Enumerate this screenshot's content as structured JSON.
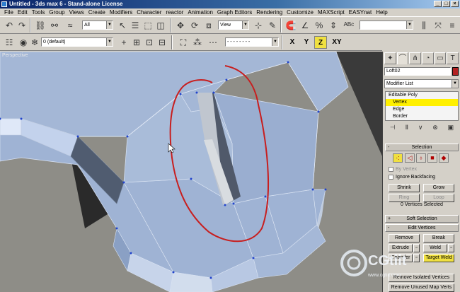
{
  "window": {
    "title": "Untitled - 3ds max 6 - Stand-alone License"
  },
  "menu": [
    "File",
    "Edit",
    "Tools",
    "Group",
    "Views",
    "Create",
    "Modifiers",
    "Character",
    "reactor",
    "Animation",
    "Graph Editors",
    "Rendering",
    "Customize",
    "MAXScript",
    "EASYnat",
    "Help"
  ],
  "toolbar": {
    "selection_filter": "All",
    "ref_coord": "View",
    "layer": "0 (default)",
    "named_selection": "",
    "axes": [
      "X",
      "Y",
      "Z",
      "XY"
    ],
    "active_axis": "Z"
  },
  "viewport": {
    "label": "Perspective"
  },
  "command_panel": {
    "object_name": "Loft02",
    "modifier_list": "Modifier List",
    "stack": [
      "Editable Poly",
      "Vertex",
      "Edge",
      "Border"
    ],
    "selected_stack_item": "Vertex",
    "selection": {
      "title": "Selection",
      "by_vertex": "By Vertex",
      "ignore_backfacing": "Ignore Backfacing",
      "shrink": "Shrink",
      "grow": "Grow",
      "ring": "Ring",
      "loop": "Loop",
      "status": "0 Vertices Selected"
    },
    "soft_selection": {
      "title": "Soft Selection"
    },
    "edit_vertices": {
      "title": "Edit Vertices",
      "remove": "Remove",
      "break": "Break",
      "extrude": "Extrude",
      "weld": "Weld",
      "chamfer": "Chamfer",
      "target_weld": "Target Weld",
      "remove_isolated": "Remove Isolated Vertices",
      "remove_unused": "Remove Unused Map Verts"
    }
  },
  "watermark": {
    "brand": "CGtiit",
    "url": "www.cgtiit.com"
  },
  "colors": {
    "title_start": "#0a246a",
    "highlight": "#f0e040",
    "selected_item": "#fff000",
    "annotation": "#c81e1e",
    "mesh": "#9fb3d4"
  }
}
